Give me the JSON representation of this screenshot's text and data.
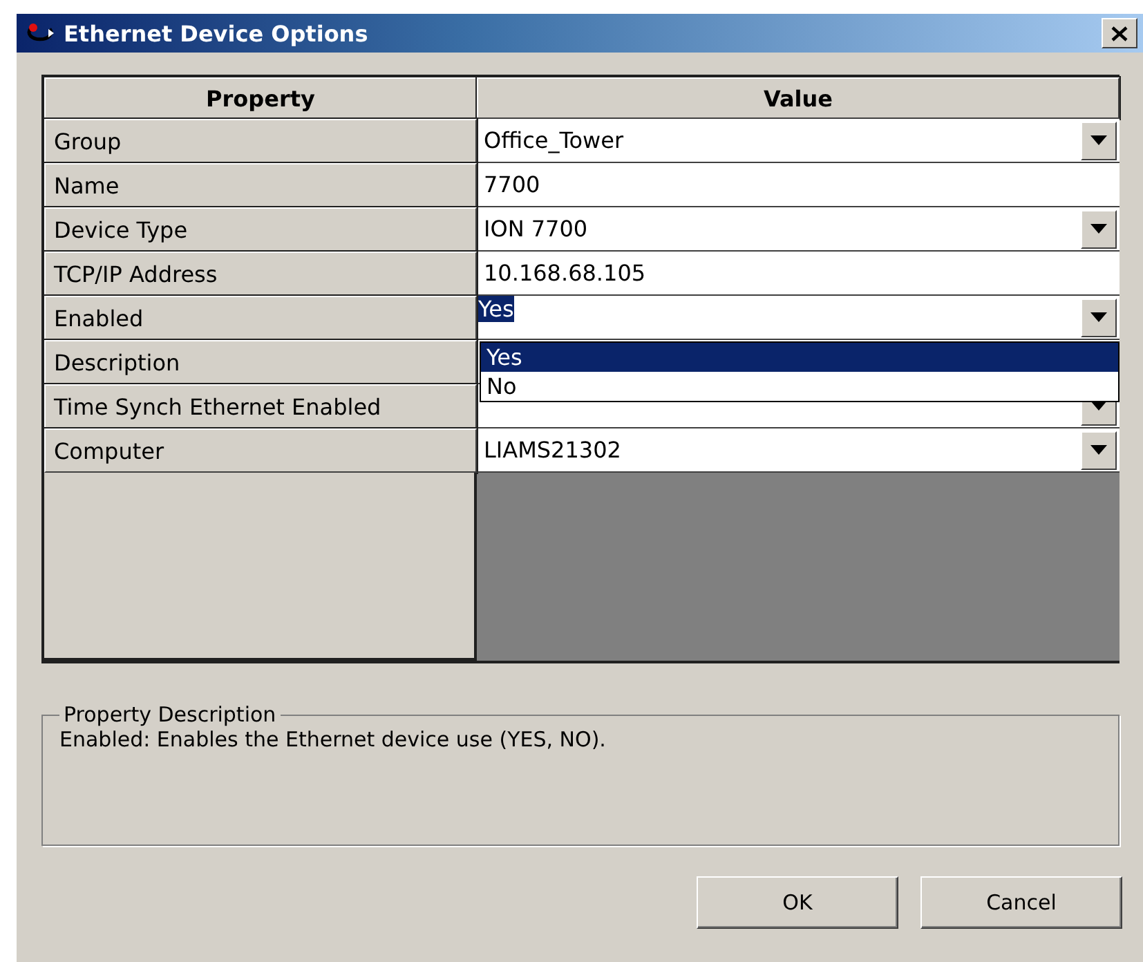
{
  "window": {
    "title": "Ethernet Device Options"
  },
  "grid": {
    "columns": [
      "Property",
      "Value"
    ],
    "rows": [
      {
        "property": "Group",
        "value": "Office_Tower",
        "kind": "dropdown"
      },
      {
        "property": "Name",
        "value": "7700",
        "kind": "text"
      },
      {
        "property": "Device Type",
        "value": "ION 7700",
        "kind": "dropdown"
      },
      {
        "property": "TCP/IP Address",
        "value": "10.168.68.105",
        "kind": "text"
      },
      {
        "property": "Enabled",
        "value": "Yes",
        "kind": "dropdown",
        "editing": true,
        "options": [
          {
            "label": "Yes",
            "selected": true
          },
          {
            "label": "No",
            "selected": false
          }
        ]
      },
      {
        "property": "Description",
        "kind": "covered"
      },
      {
        "property": "Time Synch Ethernet Enabled",
        "kind": "dropdown"
      },
      {
        "property": "Computer",
        "value": "LIAMS21302",
        "kind": "dropdown"
      }
    ]
  },
  "property_description": {
    "title": "Property Description",
    "text": "Enabled: Enables the Ethernet device use (YES, NO)."
  },
  "buttons": [
    "OK",
    "Cancel"
  ]
}
